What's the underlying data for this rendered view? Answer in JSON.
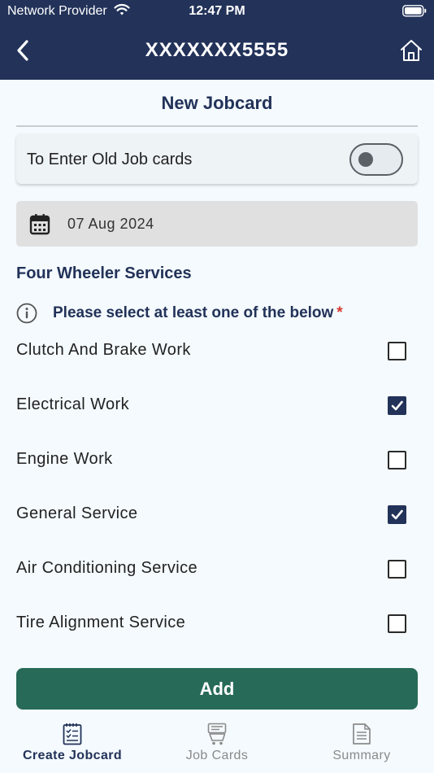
{
  "status_bar": {
    "carrier": "Network Provider",
    "time": "12:47 PM"
  },
  "header": {
    "title": "XXXXXXX5555",
    "back_icon": "chevron-left-icon",
    "home_icon": "home-icon"
  },
  "page": {
    "title": "New Jobcard"
  },
  "old_jobcards_toggle": {
    "label": "To Enter Old Job cards",
    "enabled": false
  },
  "date_field": {
    "value": "07 Aug 2024",
    "icon": "calendar-icon"
  },
  "services_section": {
    "title": "Four Wheeler Services",
    "instruction": "Please select at least one of the below",
    "required_marker": "*",
    "items": [
      {
        "label": "Clutch And Brake Work",
        "checked": false
      },
      {
        "label": "Electrical Work",
        "checked": true
      },
      {
        "label": "Engine Work",
        "checked": false
      },
      {
        "label": "General Service",
        "checked": true
      },
      {
        "label": "Air Conditioning Service",
        "checked": false
      },
      {
        "label": "Tire Alignment Service",
        "checked": false
      }
    ]
  },
  "add_button": {
    "label": "Add"
  },
  "bottom_nav": {
    "items": [
      {
        "label": "Create Jobcard",
        "icon": "create-jobcard-icon",
        "active": true
      },
      {
        "label": "Job Cards",
        "icon": "job-cards-icon",
        "active": false
      },
      {
        "label": "Summary",
        "icon": "summary-icon",
        "active": false
      }
    ]
  },
  "colors": {
    "primary": "#223259",
    "accent_green": "#286a58",
    "background": "#f4fafd",
    "required": "#d63a2f"
  }
}
